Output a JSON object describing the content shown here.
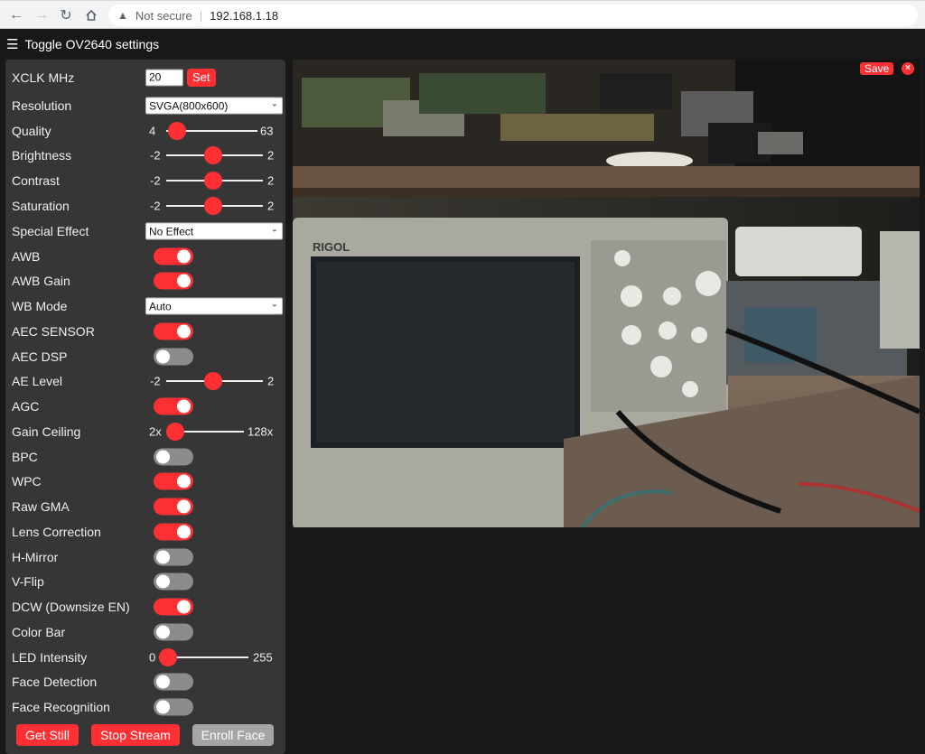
{
  "browser": {
    "security_label": "Not secure",
    "url": "192.168.1.18"
  },
  "header": {
    "toggle_label": "Toggle OV2640 settings"
  },
  "settings": {
    "xclk": {
      "label": "XCLK MHz",
      "value": "20",
      "button": "Set"
    },
    "resolution": {
      "label": "Resolution",
      "value": "SVGA(800x600)"
    },
    "quality": {
      "label": "Quality",
      "min": "4",
      "max": "63",
      "value": 10
    },
    "brightness": {
      "label": "Brightness",
      "min": "-2",
      "max": "2",
      "value": 0
    },
    "contrast": {
      "label": "Contrast",
      "min": "-2",
      "max": "2",
      "value": 0
    },
    "saturation": {
      "label": "Saturation",
      "min": "-2",
      "max": "2",
      "value": 0
    },
    "special_effect": {
      "label": "Special Effect",
      "value": "No Effect"
    },
    "awb": {
      "label": "AWB",
      "on": true
    },
    "awb_gain": {
      "label": "AWB Gain",
      "on": true
    },
    "wb_mode": {
      "label": "WB Mode",
      "value": "Auto"
    },
    "aec_sensor": {
      "label": "AEC SENSOR",
      "on": true
    },
    "aec_dsp": {
      "label": "AEC DSP",
      "on": false
    },
    "ae_level": {
      "label": "AE Level",
      "min": "-2",
      "max": "2",
      "value": 0
    },
    "agc": {
      "label": "AGC",
      "on": true
    },
    "gain_ceiling": {
      "label": "Gain Ceiling",
      "min": "2x",
      "max": "128x",
      "value": 0
    },
    "bpc": {
      "label": "BPC",
      "on": false
    },
    "wpc": {
      "label": "WPC",
      "on": true
    },
    "raw_gma": {
      "label": "Raw GMA",
      "on": true
    },
    "lens_correction": {
      "label": "Lens Correction",
      "on": true
    },
    "h_mirror": {
      "label": "H-Mirror",
      "on": false
    },
    "v_flip": {
      "label": "V-Flip",
      "on": false
    },
    "dcw": {
      "label": "DCW (Downsize EN)",
      "on": true
    },
    "color_bar": {
      "label": "Color Bar",
      "on": false
    },
    "led_intensity": {
      "label": "LED Intensity",
      "min": "0",
      "max": "255",
      "value": 0
    },
    "face_detection": {
      "label": "Face Detection",
      "on": false
    },
    "face_recognition": {
      "label": "Face Recognition",
      "on": false
    }
  },
  "buttons": {
    "get_still": "Get Still",
    "stop_stream": "Stop Stream",
    "enroll_face": "Enroll Face"
  },
  "stream": {
    "save_label": "Save",
    "close_label": "×",
    "scope_brand": "RIGOL"
  }
}
